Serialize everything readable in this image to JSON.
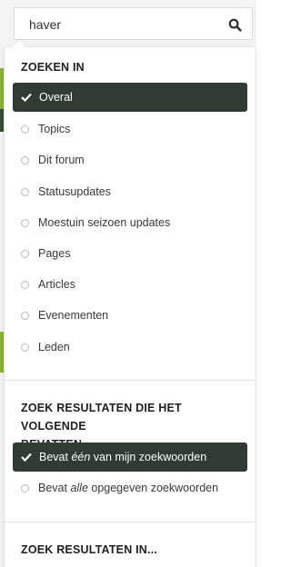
{
  "search": {
    "value": "haver",
    "icon": "search-icon"
  },
  "colors": {
    "selected_bg": "#2f3b33",
    "accent_green": "#8bb23c"
  },
  "sections": {
    "search_in": {
      "title": "ZOEKEN IN",
      "options": [
        {
          "label": "Overal",
          "selected": true
        },
        {
          "label": "Topics",
          "selected": false
        },
        {
          "label": "Dit forum",
          "selected": false
        },
        {
          "label": "Statusupdates",
          "selected": false
        },
        {
          "label": "Moestuin seizoen updates",
          "selected": false
        },
        {
          "label": "Pages",
          "selected": false
        },
        {
          "label": "Articles",
          "selected": false
        },
        {
          "label": "Evenementen",
          "selected": false
        },
        {
          "label": "Leden",
          "selected": false
        }
      ]
    },
    "results_containing": {
      "title_line1": "ZOEK RESULTATEN DIE HET VOLGENDE",
      "title_line2": "BEVATTEN...",
      "options": [
        {
          "before": "Bevat ",
          "em": "één",
          "after": " van mijn zoekwoorden",
          "selected": true
        },
        {
          "before": "Bevat ",
          "em": "alle",
          "after": " opgegeven zoekwoorden",
          "selected": false
        }
      ]
    },
    "results_in": {
      "title": "ZOEK RESULTATEN IN..."
    }
  }
}
